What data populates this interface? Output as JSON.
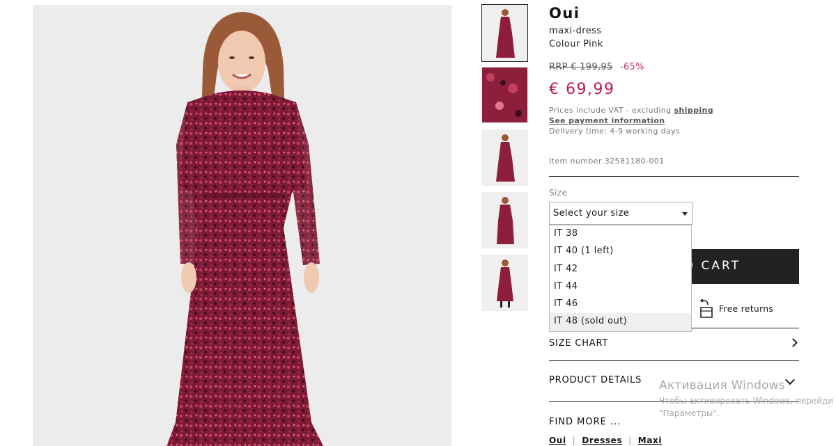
{
  "product": {
    "brand": "Oui",
    "type": "maxi-dress",
    "colour": "Colour Pink",
    "rrp": "RRP € 199,95",
    "discount": "-65%",
    "price": "€ 69,99",
    "vat_prefix": "Prices include VAT - excluding",
    "vat_link": "shipping",
    "payment_link": "See payment information",
    "delivery": "Delivery time: 4-9 working days",
    "item_number": "Item number 32581180-001"
  },
  "size": {
    "label": "Size",
    "select_placeholder": "Select your size",
    "options": [
      "IT 38",
      "IT 40 (1 left)",
      "IT 42",
      "IT 44",
      "IT 46",
      "IT 48 (sold out)"
    ]
  },
  "cart": {
    "label": "D CART"
  },
  "returns": {
    "label": "Free returns"
  },
  "accordion": {
    "size_chart": "SIZE CHART",
    "product_details": "PRODUCT DETAILS"
  },
  "find_more": {
    "label": "FIND MORE ...",
    "links": [
      "Oui",
      "Dresses",
      "Maxi"
    ]
  },
  "watermark": {
    "title": "Активация Windows",
    "line1": "Чтобы активировать Windows, перейди",
    "line2": "\"Параметры\"."
  },
  "colors": {
    "price": "#c2185b",
    "dress": "#8e1f3c",
    "button": "#222222"
  }
}
